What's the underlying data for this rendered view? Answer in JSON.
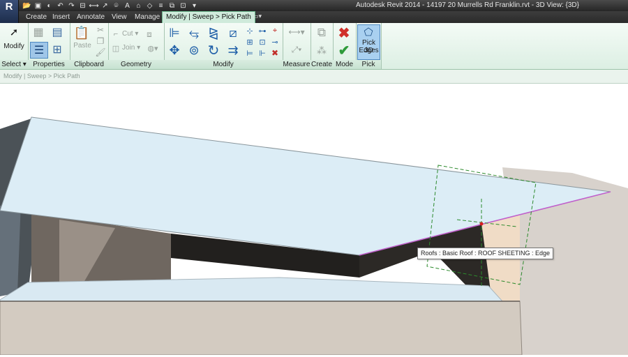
{
  "app": {
    "logo": "R",
    "title": "Autodesk Revit 2014 -   14197 20 Murrells Rd Franklin.rvt - 3D View: {3D}"
  },
  "tabs": [
    {
      "label": "Create"
    },
    {
      "label": "Insert"
    },
    {
      "label": "Annotate"
    },
    {
      "label": "View"
    },
    {
      "label": "Manage"
    },
    {
      "label": "Modify | Sweep > Pick Path"
    }
  ],
  "ribbon": {
    "modify_label": "Modify",
    "paste_label": "Paste",
    "cut_label": "Cut",
    "join_label": "Join",
    "pick3d_label_1": "Pick 3D",
    "pick3d_label_2": "Edges",
    "panels": {
      "select": "Select",
      "properties": "Properties",
      "clipboard": "Clipboard",
      "geometry": "Geometry",
      "modify": "Modify",
      "measure": "Measure",
      "create": "Create",
      "mode": "Mode",
      "pick": "Pick"
    },
    "colors": {
      "accent": "#cfeadb",
      "cancel": "#d0302a",
      "finish": "#2e9b3a"
    }
  },
  "options_bar": {
    "breadcrumb": "Modify | Sweep > Pick Path"
  },
  "viewport": {
    "tooltip": "Roofs : Basic Roof : ROOF SHEETING : Edge"
  }
}
